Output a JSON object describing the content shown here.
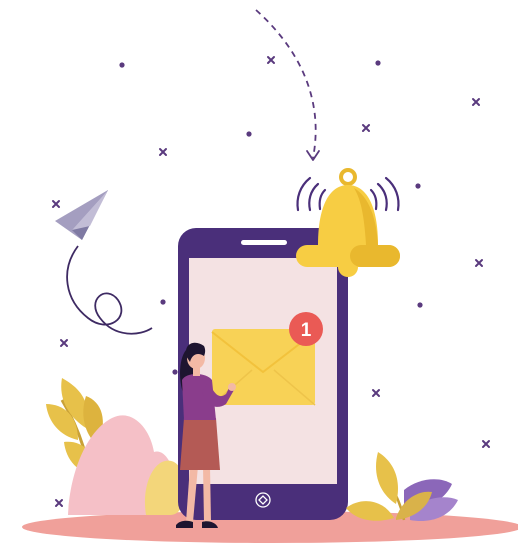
{
  "illustration": {
    "notification_badge": {
      "count": "1"
    },
    "icons": [
      "paper-plane-icon",
      "bell-icon",
      "envelope-icon",
      "notification-badge-icon",
      "sparkle-icon"
    ],
    "colors": {
      "phone_frame": "#4a2f7a",
      "phone_screen": "#f4e2e3",
      "bell": "#f7cd43",
      "bell_shade": "#e9b82e",
      "envelope": "#f8d256",
      "envelope_flap": "#f2c23c",
      "badge": "#ea5a55",
      "ground": "#f0a09a",
      "bush_pink": "#f5c0c7",
      "leaf_yellow": "#e7c14a",
      "leaf_purple": "#8b67b9",
      "plane": "#8f88ad",
      "woman_top": "#8a3d8c",
      "woman_skirt": "#b45a55",
      "woman_hair": "#1e1530",
      "skin": "#f3b9a5",
      "dots": "#5a3a7e"
    }
  }
}
